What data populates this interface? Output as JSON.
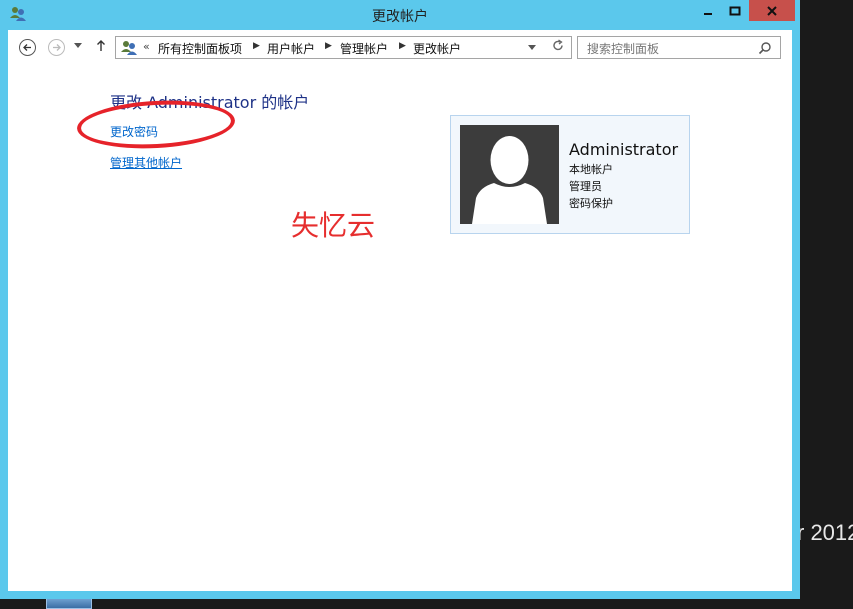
{
  "window": {
    "title": "更改帐户"
  },
  "address_bar": {
    "overflow": "«",
    "crumbs": [
      "所有控制面板项",
      "用户帐户",
      "管理帐户",
      "更改帐户"
    ]
  },
  "search": {
    "placeholder": "搜索控制面板"
  },
  "main": {
    "heading": "更改 Administrator 的帐户",
    "links": {
      "change_password": "更改密码",
      "manage_other": "管理其他帐户"
    }
  },
  "account": {
    "name": "Administrator",
    "details": [
      "本地帐户",
      "管理员",
      "密码保护"
    ]
  },
  "watermark": "失忆云",
  "desktop": {
    "partial_text": "r 2012"
  },
  "colors": {
    "window_frame": "#5bc8ec",
    "close_button": "#c7504b",
    "heading": "#1e3287",
    "link": "#0066cc",
    "annotation": "#e6232a"
  }
}
